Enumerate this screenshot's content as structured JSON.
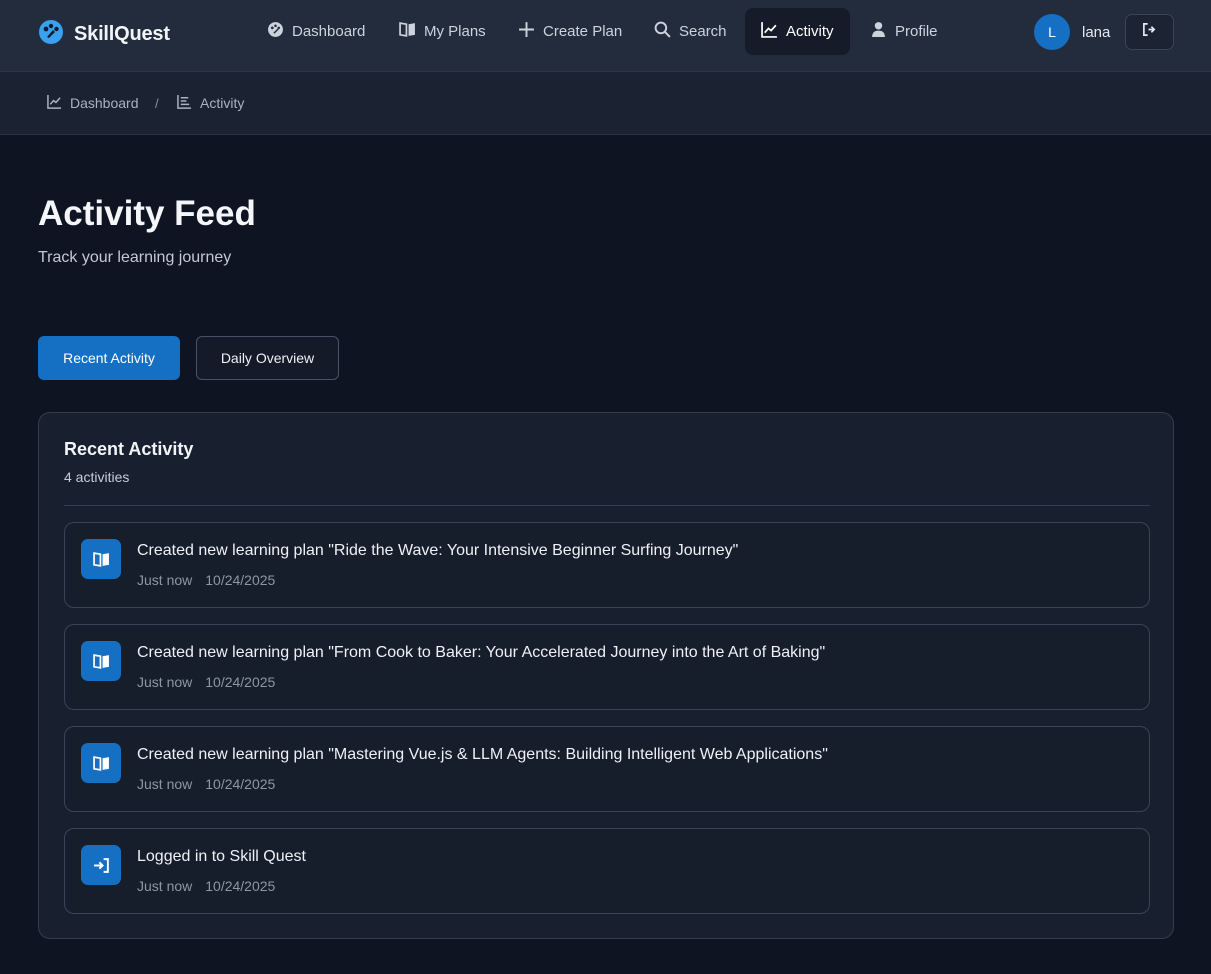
{
  "brand": {
    "name": "SkillQuest"
  },
  "nav": [
    {
      "label": "Dashboard",
      "icon": "palette-icon"
    },
    {
      "label": "My Plans",
      "icon": "book-icon"
    },
    {
      "label": "Create Plan",
      "icon": "plus-icon"
    },
    {
      "label": "Search",
      "icon": "search-icon"
    },
    {
      "label": "Activity",
      "icon": "chart-line-icon",
      "active": true
    },
    {
      "label": "Profile",
      "icon": "user-icon"
    }
  ],
  "user": {
    "initial": "L",
    "name": "lana"
  },
  "breadcrumb": [
    {
      "label": "Dashboard",
      "icon": "chart-line-icon"
    },
    {
      "label": "Activity",
      "icon": "list-icon"
    }
  ],
  "breadcrumb_separator": "/",
  "page": {
    "title": "Activity Feed",
    "subtitle": "Track your learning journey"
  },
  "tabs": [
    {
      "label": "Recent Activity",
      "active": true
    },
    {
      "label": "Daily Overview",
      "active": false
    }
  ],
  "panel": {
    "title": "Recent Activity",
    "count": "4 activities"
  },
  "activities": [
    {
      "text": "Created new learning plan \"Ride the Wave: Your Intensive Beginner Surfing Journey\"",
      "time": "Just now",
      "date": "10/24/2025",
      "icon": "book-icon"
    },
    {
      "text": "Created new learning plan \"From Cook to Baker: Your Accelerated Journey into the Art of Baking\"",
      "time": "Just now",
      "date": "10/24/2025",
      "icon": "book-icon"
    },
    {
      "text": "Created new learning plan \"Mastering Vue.js & LLM Agents: Building Intelligent Web Applications\"",
      "time": "Just now",
      "date": "10/24/2025",
      "icon": "book-icon"
    },
    {
      "text": "Logged in to Skill Quest",
      "time": "Just now",
      "date": "10/24/2025",
      "icon": "sign-in-icon"
    }
  ],
  "colors": {
    "accent": "#1570c4",
    "background": "#0f1422",
    "navbar": "#222c3c"
  }
}
